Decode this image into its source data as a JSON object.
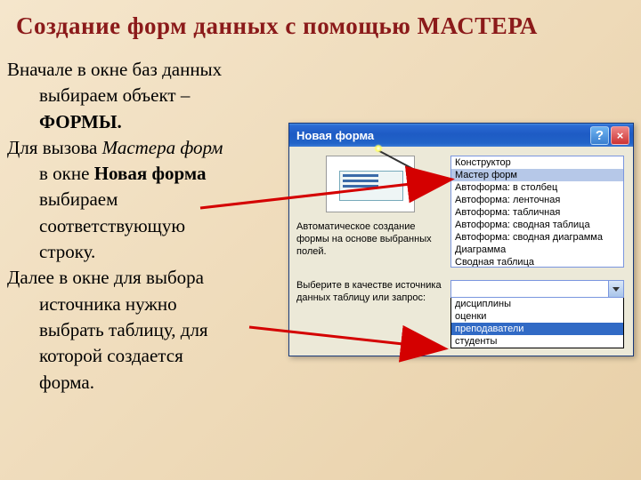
{
  "slide": {
    "title": "Создание форм данных с помощью МАСТЕРА",
    "p1a": "Вначале в окне баз данных",
    "p1b": "выбираем объект –",
    "p1c": "ФОРМЫ.",
    "p2a": "Для вызова ",
    "p2b": "Мастера форм",
    "p2c": "в окне ",
    "p2d": "Новая форма",
    "p2e": "выбираем",
    "p2f": "соответствующую",
    "p2g": "строку.",
    "p3a": "Далее в окне для выбора",
    "p3b": "источника нужно",
    "p3c": "выбрать таблицу, для",
    "p3d": "которой создается",
    "p3e": "форма."
  },
  "dialog": {
    "title": "Новая форма",
    "desc": "Автоматическое создание формы на основе выбранных полей.",
    "src_label": "Выберите в качестве источника данных таблицу или запрос:",
    "list": {
      "items": [
        "Конструктор",
        "Мастер форм",
        "Автоформа: в столбец",
        "Автоформа: ленточная",
        "Автоформа: табличная",
        "Автоформа:  сводная таблица",
        "Автоформа:  сводная диаграмма",
        "Диаграмма",
        "Сводная таблица"
      ],
      "selected_index": 1
    },
    "combo": {
      "value": ""
    },
    "dropdown": {
      "items": [
        "дисциплины",
        "оценки",
        "преподаватели",
        "студенты"
      ],
      "selected_index": 2
    }
  }
}
